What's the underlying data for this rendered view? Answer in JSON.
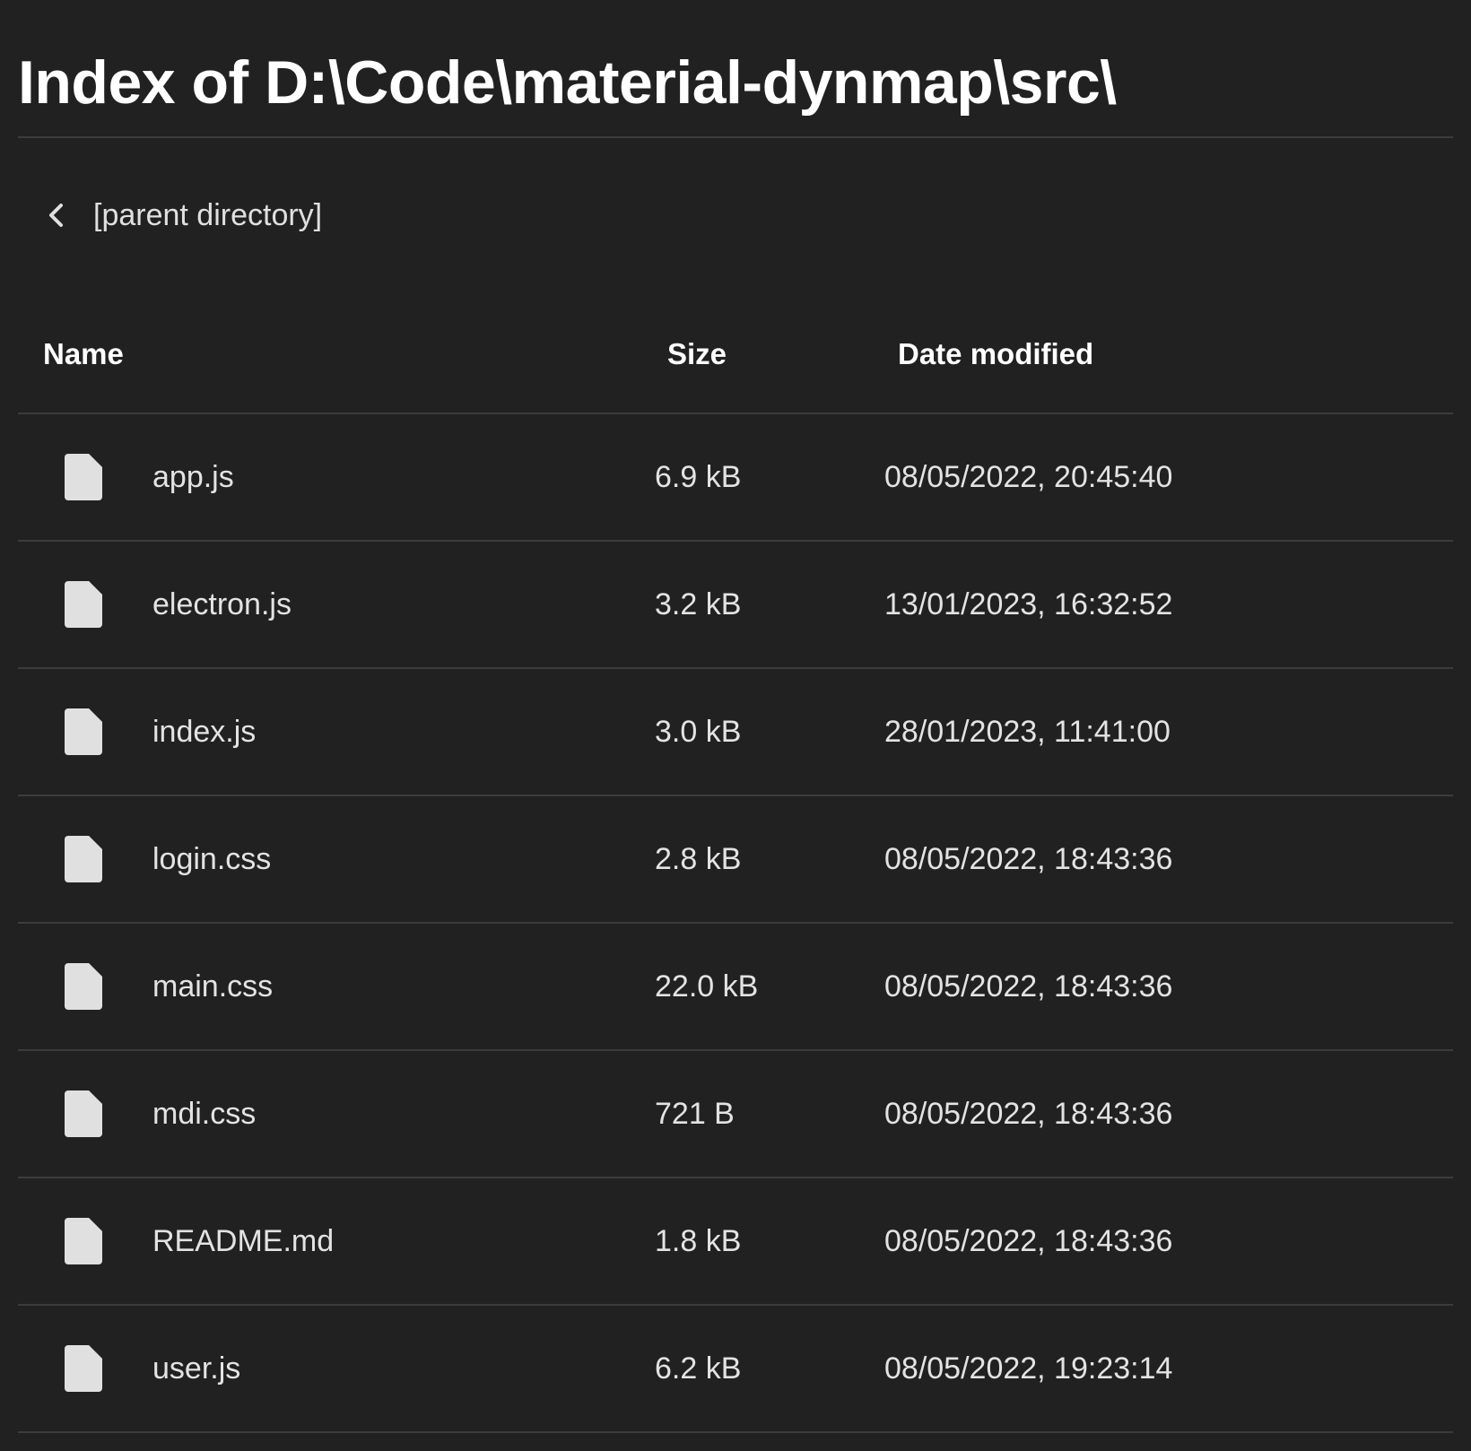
{
  "page": {
    "title": "Index of D:\\Code\\material-dynmap\\src\\"
  },
  "parent": {
    "icon": "chevron-left-icon",
    "label": "[parent directory]"
  },
  "table": {
    "headers": {
      "name": "Name",
      "size": "Size",
      "date": "Date modified"
    },
    "rows": [
      {
        "icon": "file-icon",
        "name": "app.js",
        "size": "6.9 kB",
        "date": "08/05/2022, 20:45:40"
      },
      {
        "icon": "file-icon",
        "name": "electron.js",
        "size": "3.2 kB",
        "date": "13/01/2023, 16:32:52"
      },
      {
        "icon": "file-icon",
        "name": "index.js",
        "size": "3.0 kB",
        "date": "28/01/2023, 11:41:00"
      },
      {
        "icon": "file-icon",
        "name": "login.css",
        "size": "2.8 kB",
        "date": "08/05/2022, 18:43:36"
      },
      {
        "icon": "file-icon",
        "name": "main.css",
        "size": "22.0 kB",
        "date": "08/05/2022, 18:43:36"
      },
      {
        "icon": "file-icon",
        "name": "mdi.css",
        "size": "721 B",
        "date": "08/05/2022, 18:43:36"
      },
      {
        "icon": "file-icon",
        "name": "README.md",
        "size": "1.8 kB",
        "date": "08/05/2022, 18:43:36"
      },
      {
        "icon": "file-icon",
        "name": "user.js",
        "size": "6.2 kB",
        "date": "08/05/2022, 19:23:14"
      }
    ]
  },
  "colors": {
    "background": "#212121",
    "text": "#ffffff",
    "muted_text": "#e3e3e3",
    "divider": "#3c3c3c",
    "icon": "#e0e0e0"
  }
}
